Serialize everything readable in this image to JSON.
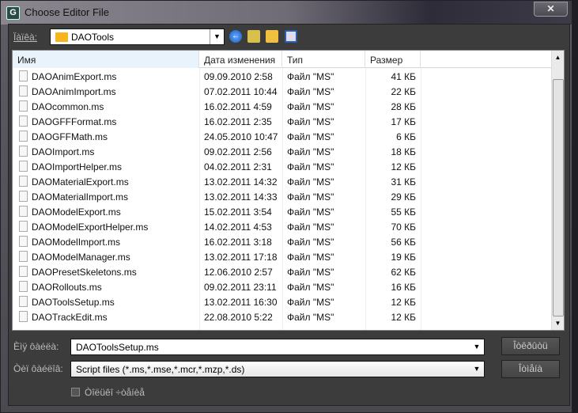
{
  "window": {
    "title": "Choose Editor File",
    "close": "✕"
  },
  "lookin": {
    "label": "Ïàïêà:",
    "value": "DAOTools"
  },
  "columns": [
    "Имя",
    "Дата изменения",
    "Тип",
    "Размер"
  ],
  "files": [
    [
      "DAOAnimExport.ms",
      "09.09.2010 2:58",
      "Файл \"MS\"",
      "41 КБ"
    ],
    [
      "DAOAnimImport.ms",
      "07.02.2011 10:44",
      "Файл \"MS\"",
      "22 КБ"
    ],
    [
      "DAOcommon.ms",
      "16.02.2011 4:59",
      "Файл \"MS\"",
      "28 КБ"
    ],
    [
      "DAOGFFFormat.ms",
      "16.02.2011 2:35",
      "Файл \"MS\"",
      "17 КБ"
    ],
    [
      "DAOGFFMath.ms",
      "24.05.2010 10:47",
      "Файл \"MS\"",
      "6 КБ"
    ],
    [
      "DAOImport.ms",
      "09.02.2011 2:56",
      "Файл \"MS\"",
      "18 КБ"
    ],
    [
      "DAOImportHelper.ms",
      "04.02.2011 2:31",
      "Файл \"MS\"",
      "12 КБ"
    ],
    [
      "DAOMaterialExport.ms",
      "13.02.2011 14:32",
      "Файл \"MS\"",
      "31 КБ"
    ],
    [
      "DAOMaterialImport.ms",
      "13.02.2011 14:33",
      "Файл \"MS\"",
      "29 КБ"
    ],
    [
      "DAOModelExport.ms",
      "15.02.2011 3:54",
      "Файл \"MS\"",
      "55 КБ"
    ],
    [
      "DAOModelExportHelper.ms",
      "14.02.2011 4:53",
      "Файл \"MS\"",
      "70 КБ"
    ],
    [
      "DAOModelImport.ms",
      "16.02.2011 3:18",
      "Файл \"MS\"",
      "56 КБ"
    ],
    [
      "DAOModelManager.ms",
      "13.02.2011 17:18",
      "Файл \"MS\"",
      "19 КБ"
    ],
    [
      "DAOPresetSkeletons.ms",
      "12.06.2010 2:57",
      "Файл \"MS\"",
      "62 КБ"
    ],
    [
      "DAORollouts.ms",
      "09.02.2011 23:11",
      "Файл \"MS\"",
      "16 КБ"
    ],
    [
      "DAOToolsSetup.ms",
      "13.02.2011 16:30",
      "Файл \"MS\"",
      "12 КБ"
    ],
    [
      "DAOTrackEdit.ms",
      "22.08.2010 5:22",
      "Файл \"MS\"",
      "12 КБ"
    ]
  ],
  "filename": {
    "label": "Èìÿ ôàéëà:",
    "value": "DAOToolsSetup.ms"
  },
  "filetype": {
    "label": "Òèï ôàéëîâ:",
    "value": "Script files (*.ms,*.mse,*.mcr,*.mzp,*.ds)"
  },
  "buttons": {
    "open": "Îòêðûòü",
    "cancel": "Îòìåíà"
  },
  "readonly": {
    "label": "Òîëüêî ÷òåíèå",
    "checked": false
  }
}
